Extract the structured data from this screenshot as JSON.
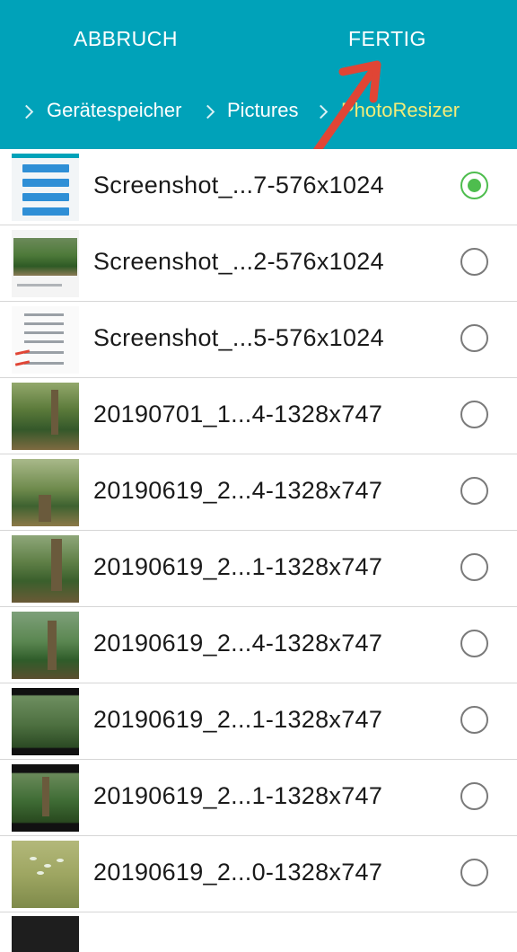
{
  "header": {
    "cancel_label": "ABBRUCH",
    "done_label": "FERTIG",
    "background_color": "#00a2b9"
  },
  "breadcrumb": {
    "items": [
      "Gerätespeicher",
      "Pictures",
      "PhotoResizer"
    ],
    "active_color": "#f3ec78"
  },
  "files": [
    {
      "name": "Screenshot_...7-576x1024",
      "selected": true
    },
    {
      "name": "Screenshot_...2-576x1024",
      "selected": false
    },
    {
      "name": "Screenshot_...5-576x1024",
      "selected": false
    },
    {
      "name": "20190701_1...4-1328x747",
      "selected": false
    },
    {
      "name": "20190619_2...4-1328x747",
      "selected": false
    },
    {
      "name": "20190619_2...1-1328x747",
      "selected": false
    },
    {
      "name": "20190619_2...4-1328x747",
      "selected": false
    },
    {
      "name": "20190619_2...1-1328x747",
      "selected": false
    },
    {
      "name": "20190619_2...1-1328x747",
      "selected": false
    },
    {
      "name": "20190619_2...0-1328x747",
      "selected": false
    }
  ],
  "annotation": {
    "arrow_color": "#e04535",
    "icon": "red-arrow-icon"
  },
  "radio_selected_color": "#4ebd4e"
}
